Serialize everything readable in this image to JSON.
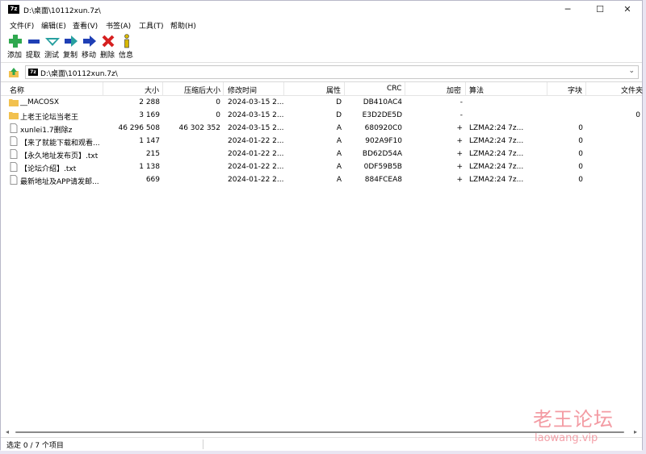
{
  "window": {
    "title": "D:\\桌面\\10112xun.7z\\",
    "app_icon_text": "7z",
    "minimize_glyph": "─",
    "maximize_glyph": "☐",
    "close_glyph": "✕"
  },
  "menu": [
    "文件(F)",
    "编辑(E)",
    "查看(V)",
    "书签(A)",
    "工具(T)",
    "帮助(H)"
  ],
  "toolbar": [
    {
      "label": "添加",
      "icon": "add-icon"
    },
    {
      "label": "提取",
      "icon": "extract-icon"
    },
    {
      "label": "测试",
      "icon": "test-icon"
    },
    {
      "label": "复制",
      "icon": "copy-icon"
    },
    {
      "label": "移动",
      "icon": "move-icon"
    },
    {
      "label": "删除",
      "icon": "delete-icon"
    },
    {
      "label": "信息",
      "icon": "info-icon"
    }
  ],
  "address": {
    "path": "D:\\桌面\\10112xun.7z\\",
    "dropdown_glyph": "⌄"
  },
  "columns": [
    "名称",
    "大小",
    "压缩后大小",
    "修改时间",
    "属性",
    "CRC",
    "加密",
    "算法",
    "字块",
    "文件夹"
  ],
  "columns_visible": [
    "名称",
    "大小",
    "压缩后大小",
    "修改时间",
    "属性",
    "CRC",
    "加密",
    "算法",
    "字块",
    "文件夹"
  ],
  "rows": [
    {
      "name": "__MACOSX",
      "type": "folder",
      "size": "2 288",
      "packed": "0",
      "modified": "2024-03-15 2...",
      "attr": "D",
      "crc": "DB410AC4",
      "encrypted": "-",
      "method": "",
      "block": "",
      "folders": ""
    },
    {
      "name": "上老王论坛当老王",
      "type": "folder",
      "size": "3 169",
      "packed": "0",
      "modified": "2024-03-15 2...",
      "attr": "D",
      "crc": "E3D2DE5D",
      "encrypted": "-",
      "method": "",
      "block": "",
      "folders": "0"
    },
    {
      "name": "xunlei1.7删除z",
      "type": "file",
      "size": "46 296 508",
      "packed": "46 302 352",
      "modified": "2024-03-15 2...",
      "attr": "A",
      "crc": "680920C0",
      "encrypted": "+",
      "method": "LZMA2:24 7z...",
      "block": "0",
      "folders": ""
    },
    {
      "name": "【来了就能下载和观看...",
      "type": "file",
      "size": "1 147",
      "packed": "",
      "modified": "2024-01-22 2...",
      "attr": "A",
      "crc": "902A9F10",
      "encrypted": "+",
      "method": "LZMA2:24 7z...",
      "block": "0",
      "folders": ""
    },
    {
      "name": "【永久地址发布页】.txt",
      "type": "file",
      "size": "215",
      "packed": "",
      "modified": "2024-01-22 2...",
      "attr": "A",
      "crc": "BD62D54A",
      "encrypted": "+",
      "method": "LZMA2:24 7z...",
      "block": "0",
      "folders": ""
    },
    {
      "name": "【论坛介绍】.txt",
      "type": "file",
      "size": "1 138",
      "packed": "",
      "modified": "2024-01-22 2...",
      "attr": "A",
      "crc": "0DF59B5B",
      "encrypted": "+",
      "method": "LZMA2:24 7z...",
      "block": "0",
      "folders": ""
    },
    {
      "name": "最新地址及APP请发邮...",
      "type": "file",
      "size": "669",
      "packed": "",
      "modified": "2024-01-22 2...",
      "attr": "A",
      "crc": "884FCEA8",
      "encrypted": "+",
      "method": "LZMA2:24 7z...",
      "block": "0",
      "folders": ""
    }
  ],
  "status": {
    "text": "选定 0 / 7 个项目"
  },
  "watermark": {
    "cn": "老王论坛",
    "en": "laowang.vip"
  },
  "colors": {
    "folder": "#f2c14e",
    "add": "#2fa84f",
    "extract": "#1f3fb5",
    "test": "#28a0a0",
    "delete": "#d62020",
    "info": "#d8b800"
  }
}
